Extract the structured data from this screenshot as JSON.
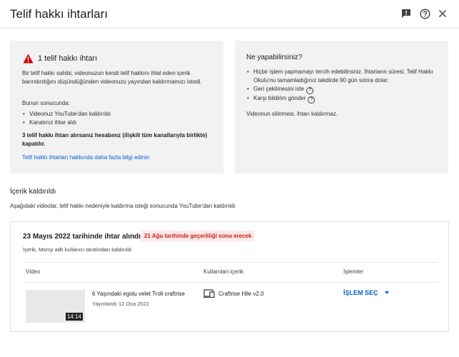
{
  "header": {
    "title": "Telif hakkı ihtarları",
    "icons": [
      "feedback-icon",
      "help-icon",
      "close-icon"
    ]
  },
  "left_panel": {
    "title": "1 telif hakkı ihtarı",
    "description": "Bir telif hakkı sahibi, videonuzun kendi telif hakkını ihlal eden içerik barındırdığını düşündüğünden videonuzu yayından kaldırmamızı istedi.",
    "result_label": "Bunun sonucunda:",
    "results": [
      "Videonuz YouTube'dan kaldırıldı",
      "Kanalınız ihtar aldı"
    ],
    "warning": "3 telif hakkı ihtarı alırsanız hesabınız (ilişkili tüm kanallarıyla birlikte) kapatılır.",
    "learn_more": "Telif hakkı ihtarları hakkında daha fazla bilgi edinin",
    "warning_color": "#cc0000"
  },
  "right_panel": {
    "title": "Ne yapabilirsiniz?",
    "options": [
      "Hiçbir işlem yapmamayı tercih edebilirsiniz. İhtarların süresi, Telif Hakkı Okulu'nu tamamladığınız takdirde 90 gün sonra dolar.",
      "Geri çekilmesini iste",
      "Karşı bildirim gönder"
    ],
    "footer": "Videonun silinmesi, ihtarı kaldırmaz."
  },
  "section": {
    "title": "İçerik kaldırıldı",
    "subtitle": "Aşağıdaki videolar, telif hakkı nedeniyle kaldırma isteği sonucunda YouTube'dan kaldırıldı"
  },
  "strike": {
    "title": "23 Mayıs 2022 tarihinde ihtar alındı",
    "expiry": "21 Ağu tarihinde geçerliliği sona erecek",
    "claimant": "İçerik, Morsy adlı kullanıcı tarafından kaldırıldı",
    "columns": [
      "Video",
      "Kullanılan içerik",
      "İşlemler"
    ],
    "row": {
      "video_title": "6 Yaşındaki egolu velet Troll craftrise",
      "published": "Yayınlandı 12 Oca 2022",
      "duration": "14:14",
      "content_used": "Craftrise Hile v2.0",
      "action": "İŞLEM SEÇ"
    },
    "colors": {
      "badge_bg": "#fce8e6",
      "badge_text": "#c5221f",
      "link": "#065fd4"
    }
  }
}
